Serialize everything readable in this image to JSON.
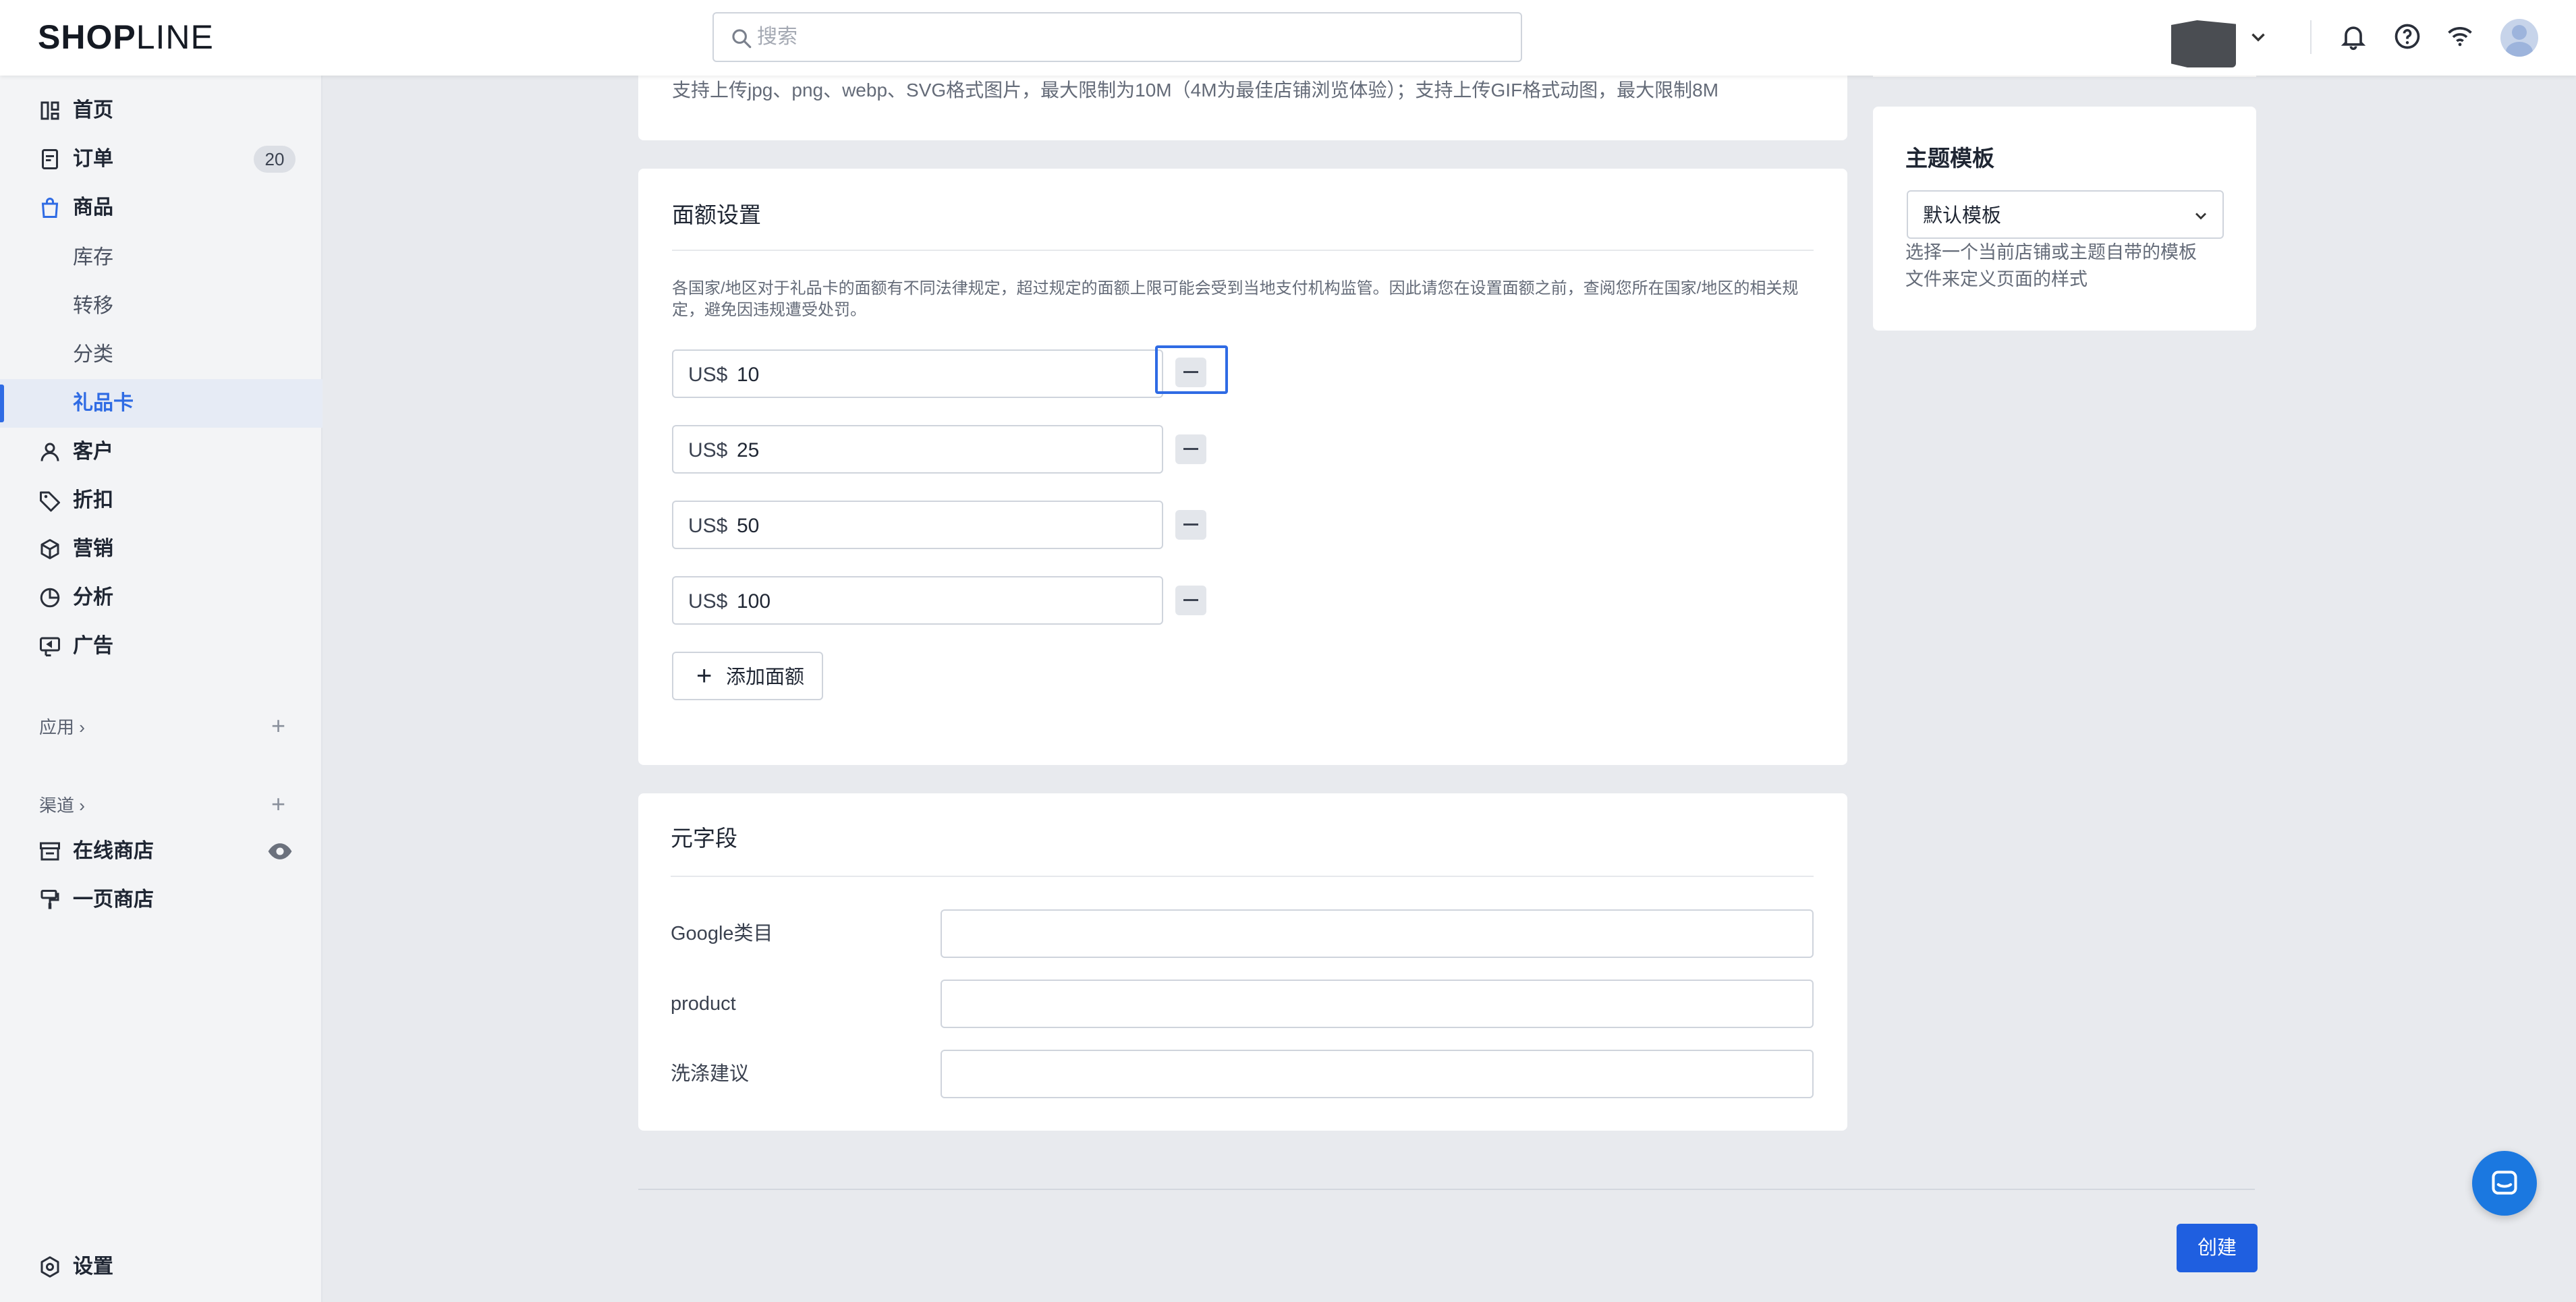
{
  "header": {
    "logo_bold": "SHOP",
    "logo_thin": "LINE",
    "search_placeholder": "搜索"
  },
  "sidebar": {
    "items": [
      {
        "label": "首页",
        "icon": "home-icon"
      },
      {
        "label": "订单",
        "icon": "order-icon",
        "badge": "20"
      },
      {
        "label": "商品",
        "icon": "bag-icon"
      },
      {
        "label": "库存"
      },
      {
        "label": "转移"
      },
      {
        "label": "分类"
      },
      {
        "label": "礼品卡",
        "active": true
      },
      {
        "label": "客户",
        "icon": "person-icon"
      },
      {
        "label": "折扣",
        "icon": "tag-icon"
      },
      {
        "label": "营销",
        "icon": "cube-icon"
      },
      {
        "label": "分析",
        "icon": "pie-chart-icon"
      },
      {
        "label": "广告",
        "icon": "ad-icon"
      }
    ],
    "apps_title": "应用",
    "channels_title": "渠道",
    "channels": [
      {
        "label": "在线商店",
        "icon": "store-icon"
      },
      {
        "label": "一页商店",
        "icon": "brush-icon"
      }
    ],
    "settings_label": "设置"
  },
  "media": {
    "hint": "支持上传jpg、png、webp、SVG格式图片，最大限制为10M（4M为最佳店铺浏览体验）；支持上传GIF格式动图，最大限制8M"
  },
  "denominations": {
    "title": "面额设置",
    "note_line1": "各国家/地区对于礼品卡的面额有不同法律规定，超过规定的面额上限可能会受到当地支付机构监管。因此请您在设置面额之前，查阅您所在国家/地区的相关规",
    "note_line2": "定，避免因违规遭受处罚。",
    "currency": "US$",
    "values": [
      "10",
      "25",
      "50",
      "100"
    ],
    "add_label": "添加面额"
  },
  "metafields": {
    "title": "元字段",
    "fields": [
      {
        "label": "Google类目",
        "value": ""
      },
      {
        "label": "product",
        "value": ""
      },
      {
        "label": "洗涤建议",
        "value": ""
      }
    ]
  },
  "theme": {
    "title": "主题模板",
    "selected": "默认模板",
    "desc_line1": "选择一个当前店铺或主题自带的模板",
    "desc_line2": "文件来定义页面的样式"
  },
  "footer": {
    "create_label": "创建"
  },
  "colors": {
    "accent": "#2f6be4",
    "primary_button": "#1f5fe0",
    "chat": "#1b78e0"
  }
}
